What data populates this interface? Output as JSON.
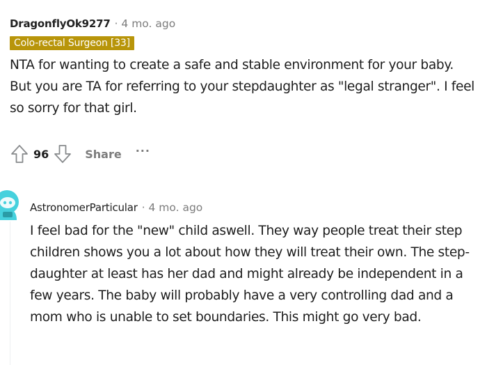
{
  "comment": {
    "username": "DragonflyOk9277",
    "separator": "·",
    "timestamp": "4 mo. ago",
    "flair": "Colo-rectal Surgeon [33]",
    "text": "NTA for wanting to create a safe and stable environment for your baby. But you are TA for referring to your stepdaughter as \"legal stranger\". I feel so sorry for that girl.",
    "votes": "96",
    "share_label": "Share",
    "more_label": "···"
  },
  "reply": {
    "username": "AstronomerParticular",
    "separator": "·",
    "timestamp": "4 mo. ago",
    "text": "I feel bad for the \"new\" child aswell. They way people treat their step children shows you a lot about how they will treat their own. The step-daughter at least has her dad and might already be independent in a few years. The baby will probably have a very controlling dad and a mom who is unable to set boundaries. This might go very bad."
  },
  "colors": {
    "flair_background": "#b8950a",
    "meta_gray": "#7c7c7c",
    "text": "#1c1c1c",
    "avatar": "#46d1dd"
  },
  "icons": {
    "upvote": "arrow-up-outline",
    "downvote": "arrow-down-outline",
    "avatar": "snoo-avatar"
  }
}
